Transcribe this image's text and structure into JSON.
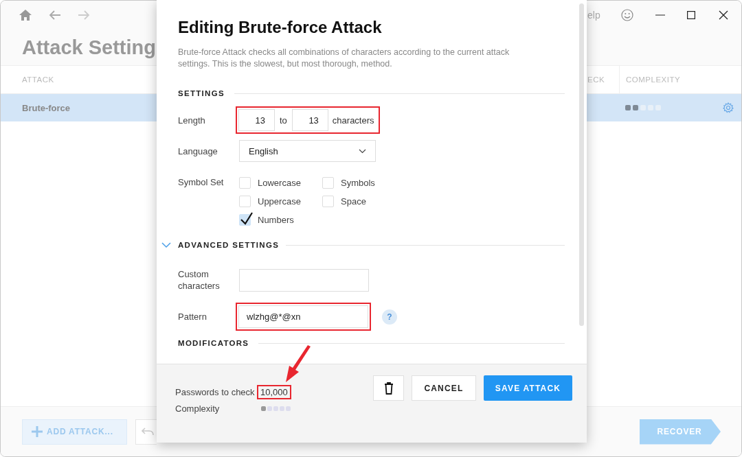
{
  "window": {
    "help_label": "elp"
  },
  "page": {
    "title": "Attack Setting"
  },
  "table": {
    "columns": [
      "ATTACK",
      "ECK",
      "COMPLEXITY"
    ],
    "rows": [
      {
        "attack": "Brute-force",
        "stars": 2,
        "selected": true
      }
    ]
  },
  "bottom_bar": {
    "add_button": "ADD ATTACK...",
    "recover_button": "RECOVER",
    "recover_disabled": true
  },
  "dialog": {
    "title": "Editing Brute-force Attack",
    "description": "Brute-force Attack checks all combinations of characters according to the current attack settings. This is the slowest, but most thorough, method.",
    "settings_heading": "SETTINGS",
    "length": {
      "label": "Length",
      "from": "13",
      "separator": "to",
      "to": "13",
      "unit": "characters",
      "highlighted": true
    },
    "language": {
      "label": "Language",
      "value": "English"
    },
    "symbol_set": {
      "label": "Symbol Set",
      "options": [
        {
          "label": "Lowercase",
          "checked": false
        },
        {
          "label": "Symbols",
          "checked": false
        },
        {
          "label": "Uppercase",
          "checked": false
        },
        {
          "label": "Space",
          "checked": false
        },
        {
          "label": "Numbers",
          "checked": true
        }
      ]
    },
    "advanced": {
      "heading": "ADVANCED SETTINGS",
      "expanded": true,
      "custom_label": "Custom characters",
      "pattern": {
        "label": "Pattern",
        "value": "wlzhg@*@xn",
        "highlighted": true
      },
      "help_glyph": "?"
    },
    "modificators_heading": "MODIFICATORS",
    "footer": {
      "passwords_label": "Passwords to check",
      "passwords_value": "10,000",
      "passwords_highlighted": true,
      "complexity_label": "Complexity",
      "stars": 1
    },
    "buttons": {
      "cancel": "CANCEL",
      "save": "SAVE ATTACK"
    }
  }
}
